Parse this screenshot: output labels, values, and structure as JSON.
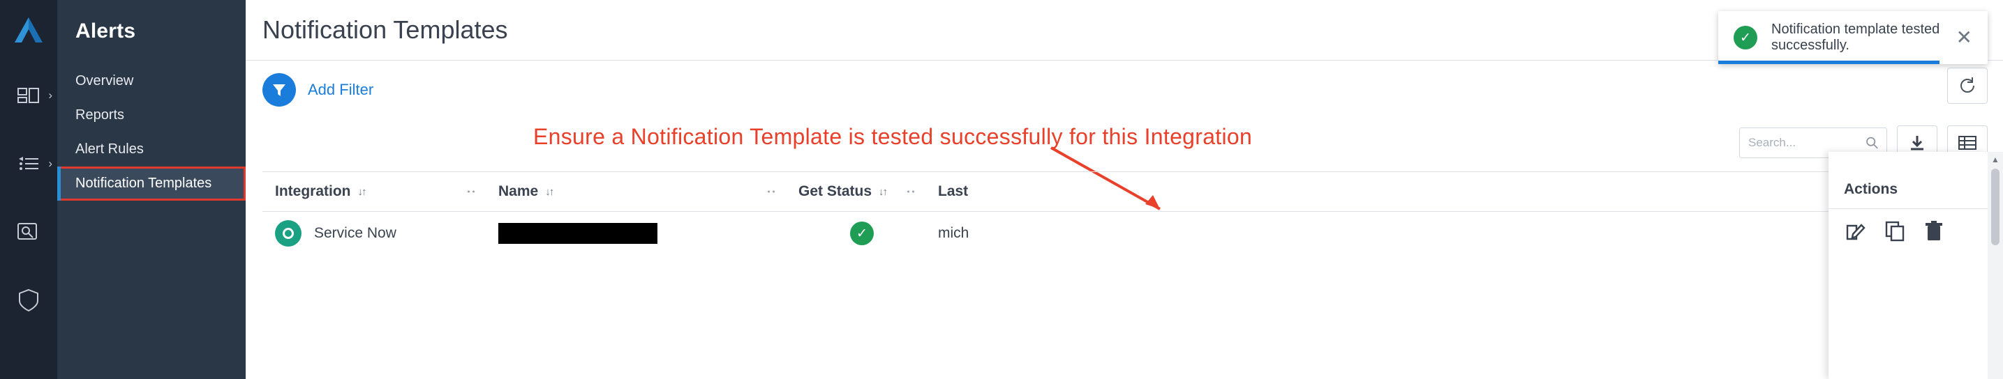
{
  "rail": {
    "logo_icon": "triangle-logo-icon",
    "items": [
      {
        "icon": "dashboard-icon",
        "chevron": "›",
        "name": "rail-item-dashboard"
      },
      {
        "icon": "list-icon",
        "chevron": "›",
        "name": "rail-item-list"
      },
      {
        "icon": "alert-search-icon",
        "chevron": "",
        "name": "rail-item-alerts"
      },
      {
        "icon": "shield-icon",
        "chevron": "",
        "name": "rail-item-shield"
      }
    ]
  },
  "sidebar": {
    "title": "Alerts",
    "items": [
      {
        "label": "Overview",
        "active": false,
        "highlighted": false
      },
      {
        "label": "Reports",
        "active": false,
        "highlighted": false
      },
      {
        "label": "Alert Rules",
        "active": false,
        "highlighted": false
      },
      {
        "label": "Notification Templates",
        "active": true,
        "highlighted": true
      }
    ]
  },
  "header": {
    "title": "Notification Templates"
  },
  "filter": {
    "icon": "funnel-icon",
    "add_filter_label": "Add Filter",
    "reset_icon": "reset-arrow-icon"
  },
  "annotation": {
    "text": "Ensure a  Notification Template is tested successfully for this Integration",
    "color": "#e8402a",
    "arrow_icon": "arrow-pointer-icon"
  },
  "search": {
    "placeholder": "Search...",
    "value": "",
    "search_icon": "search-icon",
    "download_icon": "download-icon",
    "columns_icon": "columns-grid-icon"
  },
  "table": {
    "columns": [
      {
        "label": "Integration",
        "sort": "↓↑",
        "has_grip": true
      },
      {
        "label": "Name",
        "sort": "↓↑",
        "has_grip": true
      },
      {
        "label": "Get Status",
        "sort": "↓↑",
        "has_grip": true
      },
      {
        "label": "Last",
        "sort": "",
        "has_grip": false
      }
    ],
    "rows": [
      {
        "integration_icon": "service-now-icon",
        "integration": "Service Now",
        "name_redacted": true,
        "name": "",
        "get_status": "success",
        "get_status_icon": "check-circle-icon",
        "last": "mich"
      }
    ]
  },
  "actions_panel": {
    "header": "Actions",
    "buttons": [
      {
        "icon": "edit-pencil-icon",
        "name": "edit-action-button"
      },
      {
        "icon": "copy-icon",
        "name": "copy-action-button"
      },
      {
        "icon": "trash-icon",
        "name": "delete-action-button"
      }
    ]
  },
  "toast": {
    "message": "Notification template tested successfully.",
    "icon": "check-circle-icon",
    "close_icon": "close-icon",
    "accent_color": "#1a7ddb",
    "success_color": "#1f9d55"
  },
  "scrollbar": {
    "up_arrow": "▲"
  }
}
